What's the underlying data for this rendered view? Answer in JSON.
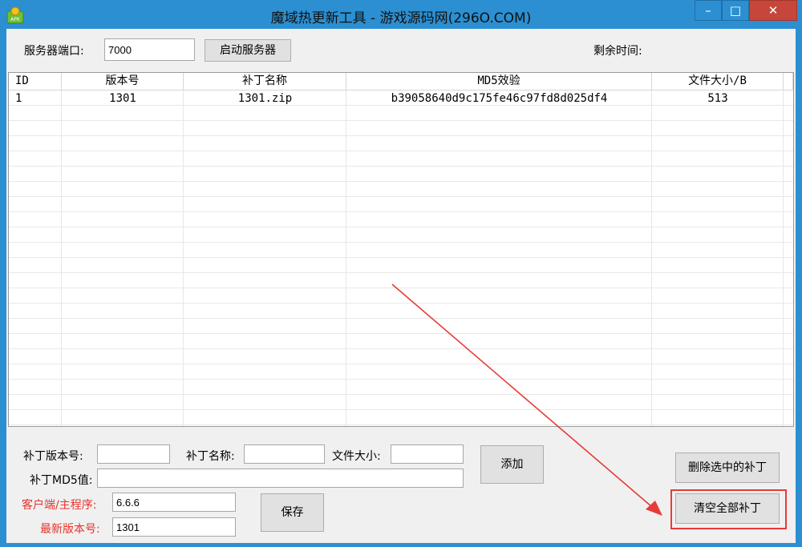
{
  "window": {
    "title": "魔域热更新工具 - 游戏源码网(296O.COM)",
    "controls": {
      "minimize": "–",
      "maximize": "□",
      "close": "✕"
    }
  },
  "server": {
    "port_label": "服务器端口:",
    "port_value": "7000",
    "start_button": "启动服务器",
    "remaining_label": "剩余时间:"
  },
  "table": {
    "columns": [
      "ID",
      "版本号",
      "补丁名称",
      "MD5效验",
      "文件大小/B"
    ],
    "rows": [
      [
        "1",
        "1301",
        "1301.zip",
        "b39058640d9c175fe46c97fd8d025df4",
        "513"
      ]
    ]
  },
  "form": {
    "patch_version_label": "补丁版本号:",
    "patch_version_value": "",
    "patch_name_label": "补丁名称:",
    "patch_name_value": "",
    "file_size_label": "文件大小:",
    "file_size_value": "",
    "md5_label": "补丁MD5值:",
    "md5_value": "",
    "client_label": "客户端/主程序:",
    "client_value": "6.6.6",
    "latest_label": "最新版本号:",
    "latest_value": "1301",
    "add_button": "添加",
    "save_button": "保存",
    "delete_selected_button": "删除选中的补丁",
    "clear_all_button": "清空全部补丁"
  },
  "colors": {
    "titlebar": "#2c8fd1",
    "close_button": "#c7463b",
    "annotation_red": "#e63b36",
    "label_red": "#e8322b"
  }
}
